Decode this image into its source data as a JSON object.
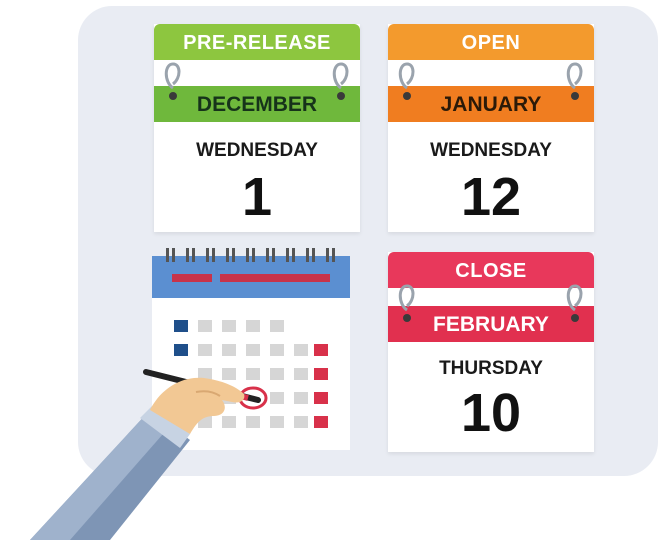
{
  "cards": [
    {
      "tab": "PRE-RELEASE",
      "month": "DECEMBER",
      "weekday": "WEDNESDAY",
      "day": "1",
      "tab_color": "#8dc63f",
      "month_color": "#6fb83c",
      "month_text_color": "#16331a"
    },
    {
      "tab": "OPEN",
      "month": "JANUARY",
      "weekday": "WEDNESDAY",
      "day": "12",
      "tab_color": "#f39a2d",
      "month_color": "#f07d20",
      "month_text_color": "#2b1a08"
    },
    {
      "tab": "CLOSE",
      "month": "FEBRUARY",
      "weekday": "THURSDAY",
      "day": "10",
      "tab_color": "#e8385b",
      "month_color": "#e1304f",
      "month_text_color": "#ffffff"
    }
  ],
  "colors": {
    "board": "#e9ecf3",
    "calendar_header": "#5b8fd1",
    "calendar_bar": "#c8334a",
    "grid_gray": "#d6d6d6",
    "grid_blue": "#1f4f8a",
    "grid_red": "#d8314a",
    "sleeve": "#7e95b5",
    "skin": "#f2c894",
    "pen_circle": "#d8314a"
  },
  "icons": [
    "ring-binder-icon",
    "wall-calendar-icon",
    "hand-with-pen-icon"
  ]
}
